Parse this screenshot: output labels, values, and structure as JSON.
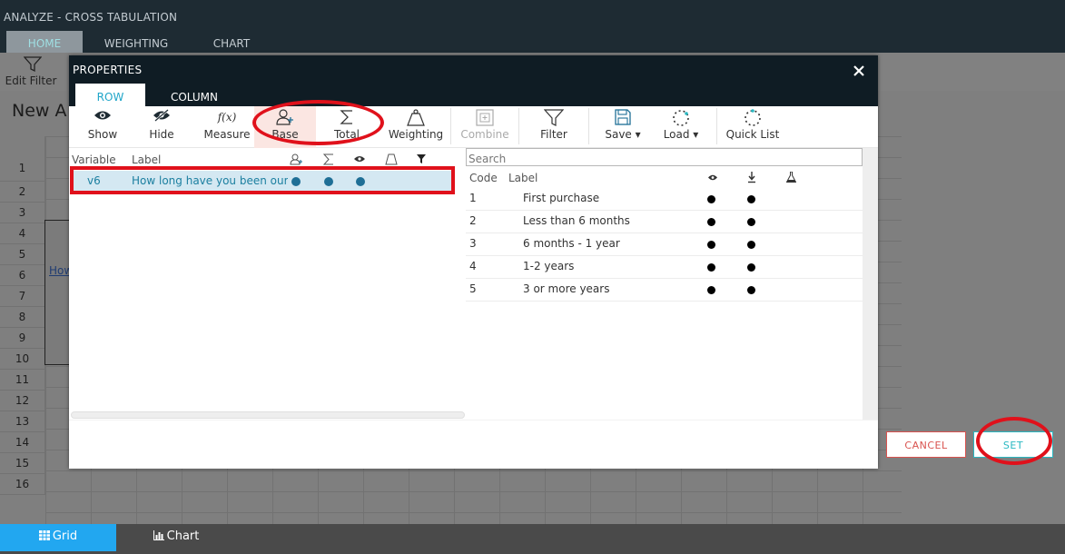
{
  "app": {
    "title": "ANALYZE - CROSS TABULATION",
    "tabs": [
      "HOME",
      "WEIGHTING",
      "CHART"
    ],
    "toolbar_edit_filter": "Edit Filter",
    "heading": "New A",
    "row_numbers": [
      "1",
      "2",
      "3",
      "4",
      "5",
      "6",
      "7",
      "8",
      "9",
      "10",
      "11",
      "12",
      "13",
      "14",
      "15",
      "16"
    ],
    "grid_link": "How",
    "bottom_tabs": [
      "Grid",
      "Chart"
    ]
  },
  "modal": {
    "title": "PROPERTIES",
    "tabs": {
      "row": "ROW",
      "column": "COLUMN"
    },
    "toolbar": {
      "show": "Show",
      "hide": "Hide",
      "measure": "Measure",
      "measure_glyph": "f(x)",
      "base": "Base",
      "total": "Total",
      "weighting": "Weighting",
      "combine": "Combine",
      "filter": "Filter",
      "save": "Save ▾",
      "load": "Load ▾",
      "quick_list": "Quick List"
    },
    "left_panel": {
      "headers": {
        "variable": "Variable",
        "label": "Label"
      },
      "rows": [
        {
          "variable": "v6",
          "label": "How long have you been our c",
          "base": true,
          "total": true,
          "show": true
        }
      ]
    },
    "right_panel": {
      "search_placeholder": "Search",
      "headers": {
        "code": "Code",
        "label": "Label"
      },
      "rows": [
        {
          "code": "1",
          "label": "First purchase",
          "show": true,
          "base": true
        },
        {
          "code": "2",
          "label": "Less than 6 months",
          "show": true,
          "base": true
        },
        {
          "code": "3",
          "label": "6 months - 1 year",
          "show": true,
          "base": true
        },
        {
          "code": "4",
          "label": "1-2 years",
          "show": true,
          "base": true
        },
        {
          "code": "5",
          "label": "3 or more years",
          "show": true,
          "base": true
        }
      ]
    },
    "buttons": {
      "cancel": "CANCEL",
      "set": "SET"
    }
  },
  "colors": {
    "header_dark": "#0f1c24",
    "accent_teal": "#29b8c2",
    "cancel_red": "#d9534f",
    "annotation_red": "#e0111b",
    "grid_tab_blue": "#22a7f0"
  }
}
